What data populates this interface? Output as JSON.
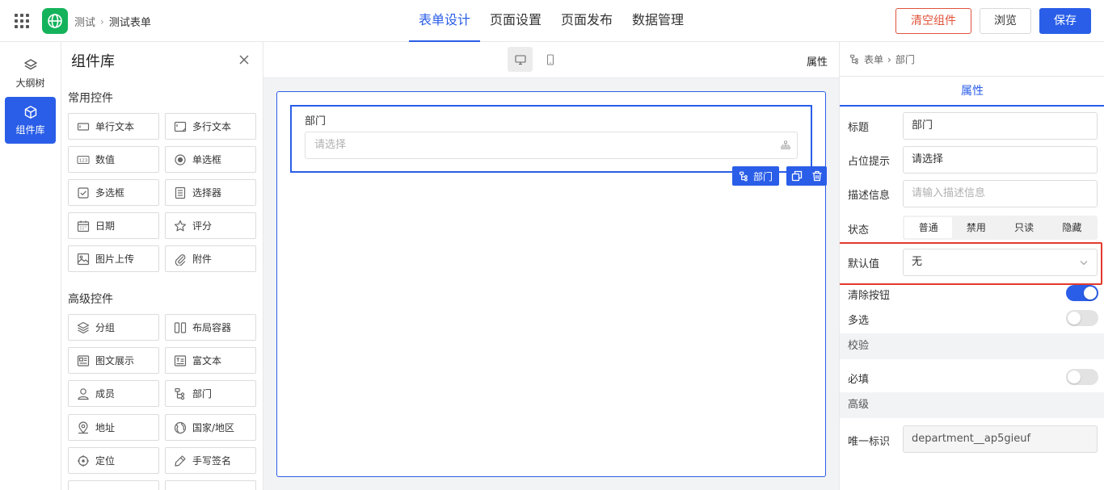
{
  "header": {
    "breadcrumb": [
      "测试",
      "测试表单"
    ],
    "nav": [
      "表单设计",
      "页面设置",
      "页面发布",
      "数据管理"
    ],
    "nav_active": 0,
    "buttons": {
      "clear": "清空组件",
      "preview": "浏览",
      "save": "保存"
    },
    "accent": "#2a5ee8",
    "danger": "#e0533a",
    "logo_color": "#14b35b"
  },
  "rail": {
    "items": [
      {
        "label": "大纲树",
        "icon": "layers-icon"
      },
      {
        "label": "组件库",
        "icon": "cube-icon"
      }
    ],
    "active": 1
  },
  "library": {
    "title": "组件库",
    "groups": [
      {
        "title": "常用控件",
        "items": [
          {
            "label": "单行文本",
            "icon": "single-line-text-icon"
          },
          {
            "label": "多行文本",
            "icon": "multi-line-text-icon"
          },
          {
            "label": "数值",
            "icon": "number-icon"
          },
          {
            "label": "单选框",
            "icon": "radio-icon"
          },
          {
            "label": "多选框",
            "icon": "checkbox-icon"
          },
          {
            "label": "选择器",
            "icon": "select-icon"
          },
          {
            "label": "日期",
            "icon": "calendar-icon"
          },
          {
            "label": "评分",
            "icon": "star-icon"
          },
          {
            "label": "图片上传",
            "icon": "image-icon"
          },
          {
            "label": "附件",
            "icon": "paperclip-icon"
          }
        ]
      },
      {
        "title": "高级控件",
        "items": [
          {
            "label": "分组",
            "icon": "layers-icon"
          },
          {
            "label": "布局容器",
            "icon": "columns-icon"
          },
          {
            "label": "图文展示",
            "icon": "media-card-icon"
          },
          {
            "label": "富文本",
            "icon": "rich-text-icon"
          },
          {
            "label": "成员",
            "icon": "user-icon"
          },
          {
            "label": "部门",
            "icon": "org-tree-icon"
          },
          {
            "label": "地址",
            "icon": "map-pin-icon"
          },
          {
            "label": "国家/地区",
            "icon": "globe-icon"
          },
          {
            "label": "定位",
            "icon": "locate-icon"
          },
          {
            "label": "手写签名",
            "icon": "pen-icon"
          }
        ]
      }
    ]
  },
  "canvas": {
    "attr_label": "属性",
    "field": {
      "label": "部门",
      "placeholder": "请选择",
      "tag": "部门"
    }
  },
  "props": {
    "breadcrumb": [
      "表单",
      "部门"
    ],
    "tab": "属性",
    "title_label": "标题",
    "title_value": "部门",
    "placeholder_label": "占位提示",
    "placeholder_value": "请选择",
    "desc_label": "描述信息",
    "desc_placeholder": "请输入描述信息",
    "status_label": "状态",
    "status_options": [
      "普通",
      "禁用",
      "只读",
      "隐藏"
    ],
    "status_active": 0,
    "default_label": "默认值",
    "default_value": "无",
    "clear_btn_label": "清除按钮",
    "clear_btn_on": true,
    "multi_label": "多选",
    "multi_on": false,
    "section_validate": "校验",
    "required_label": "必填",
    "required_on": false,
    "section_advanced": "高级",
    "uid_label": "唯一标识",
    "uid_value": "department__ap5gieuf",
    "highlight_color": "#e33a2d"
  }
}
